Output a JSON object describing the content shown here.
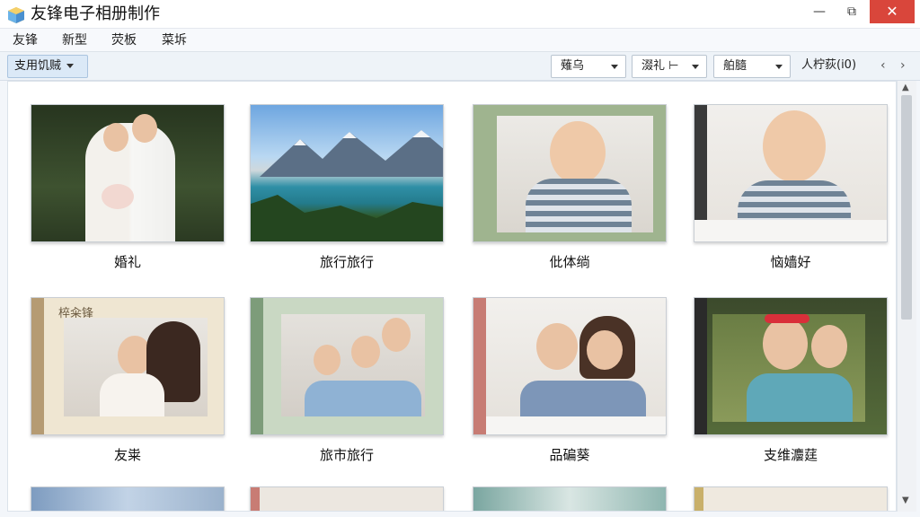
{
  "window": {
    "title": "友锋电子相册制作",
    "minimize": "—",
    "maximize": "⧉",
    "close": "✕"
  },
  "menu": [
    "友锋",
    "新型",
    "荧板",
    "菜坼"
  ],
  "toolbar": {
    "theme_button": "支用饥贼",
    "dropdowns": [
      "薙乌",
      "涰礼 ⊢",
      "舶膸"
    ],
    "count_label": "人柠荻(i0)",
    "prev": "‹",
    "next": "›"
  },
  "albums": [
    {
      "label": "婚礼",
      "icon": "wedding-photo"
    },
    {
      "label": "旅行旅行",
      "icon": "mountain-lake-photo"
    },
    {
      "label": "仳体绱",
      "icon": "baby-photo"
    },
    {
      "label": "恼嫱好",
      "icon": "baby-photo"
    },
    {
      "label": "友粜",
      "icon": "mother-child-photo",
      "frame_text": "椊籴锋"
    },
    {
      "label": "旅市旅行",
      "icon": "family-photo"
    },
    {
      "label": "品碥葵",
      "icon": "mother-child-photo"
    },
    {
      "label": "支维灋莛",
      "icon": "girls-photo"
    }
  ],
  "scrollbar": {
    "up": "▲",
    "down": "▼"
  },
  "colors": {
    "close": "#d9463b",
    "accent": "#dbe9f7"
  }
}
